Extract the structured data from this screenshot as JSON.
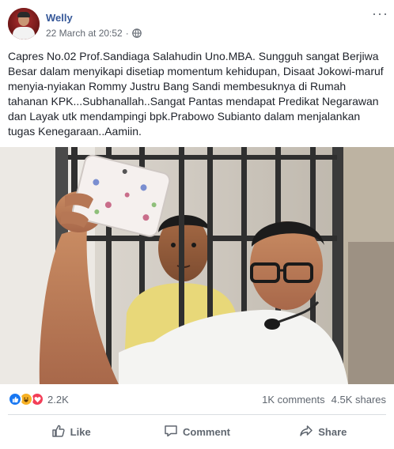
{
  "post": {
    "author": "Welly",
    "timestamp": "22 March at 20:52",
    "separator": "·",
    "privacy_icon": "globe-icon",
    "options_icon": "more-options-icon",
    "options_glyph": "···",
    "text": "Capres No.02 Prof.Sandiaga Salahudin Uno.MBA. Sungguh sangat Berjiwa Besar dalam menyikapi disetiap momentum kehidupan, Disaat Jokowi-maruf menyia-nyiakan Rommy Justru Bang Sandi membesuknya di Rumah tahanan KPK...Subhanallah..Sangat Pantas mendapat Predikat Negarawan dan Layak utk mendampingi bpk.Prabowo Subianto dalam menjalankan tugas Kenegaraan..Aamiin."
  },
  "stats": {
    "reaction_icons": [
      "like-reaction-icon",
      "haha-reaction-icon",
      "love-reaction-icon"
    ],
    "reaction_count": "2.2K",
    "comments": "1K comments",
    "shares": "4.5K shares"
  },
  "actions": {
    "like": "Like",
    "comment": "Comment",
    "share": "Share"
  },
  "colors": {
    "author_link": "#365899",
    "like_blue": "#1877f2",
    "haha_yellow": "#f7b125",
    "love_red": "#f33e58",
    "secondary_text": "#606770"
  }
}
